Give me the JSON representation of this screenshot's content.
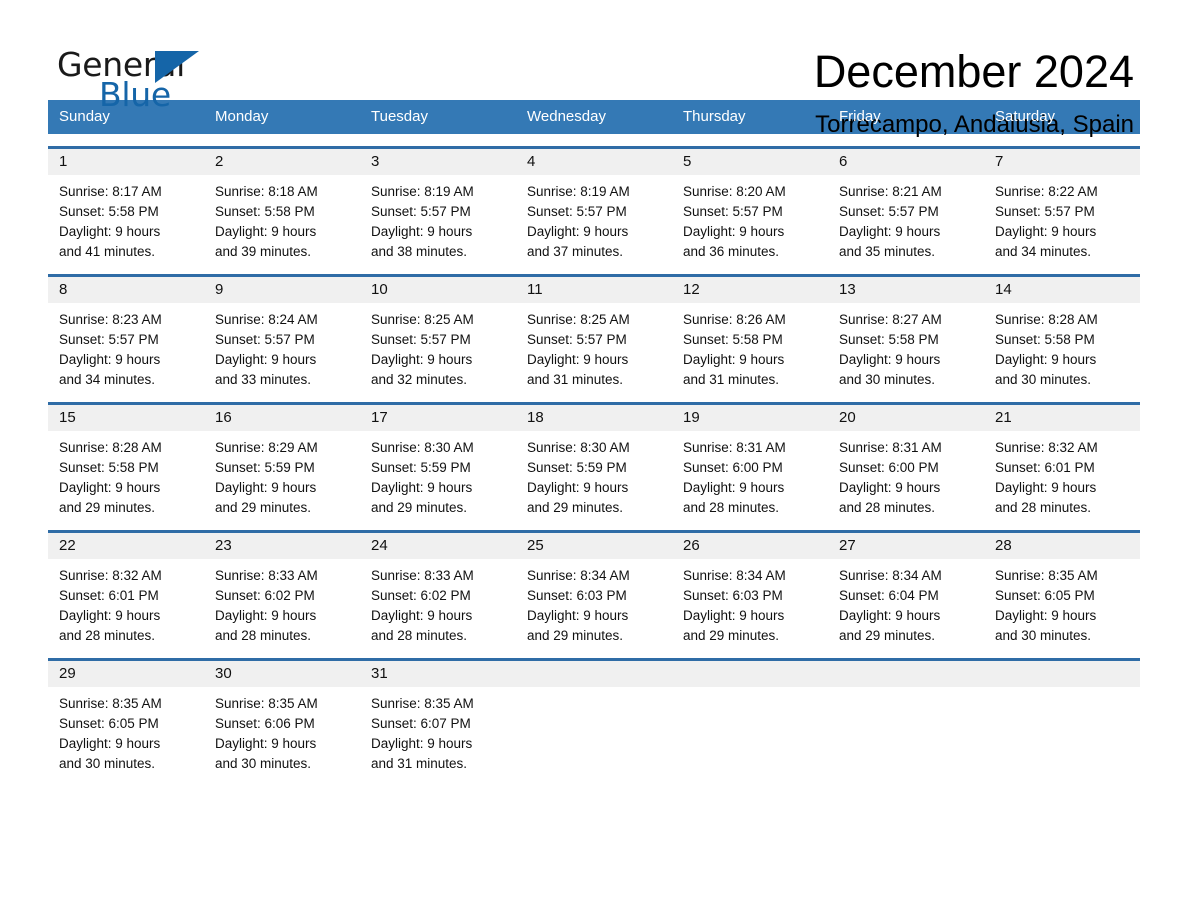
{
  "logo": {
    "word_one": "General",
    "word_two": "Blue",
    "accent_color": "#1565a8"
  },
  "header": {
    "title": "December 2024",
    "subtitle": "Torrecampo, Andalusia, Spain"
  },
  "theme": {
    "header_bar": "#3479b5",
    "row_divider": "#2f6ca6",
    "daynum_band": "#f0f0f0"
  },
  "weekdays": [
    "Sunday",
    "Monday",
    "Tuesday",
    "Wednesday",
    "Thursday",
    "Friday",
    "Saturday"
  ],
  "weeks": [
    [
      {
        "day": "1",
        "sunrise": "Sunrise: 8:17 AM",
        "sunset": "Sunset: 5:58 PM",
        "daylight1": "Daylight: 9 hours",
        "daylight2": "and 41 minutes."
      },
      {
        "day": "2",
        "sunrise": "Sunrise: 8:18 AM",
        "sunset": "Sunset: 5:58 PM",
        "daylight1": "Daylight: 9 hours",
        "daylight2": "and 39 minutes."
      },
      {
        "day": "3",
        "sunrise": "Sunrise: 8:19 AM",
        "sunset": "Sunset: 5:57 PM",
        "daylight1": "Daylight: 9 hours",
        "daylight2": "and 38 minutes."
      },
      {
        "day": "4",
        "sunrise": "Sunrise: 8:19 AM",
        "sunset": "Sunset: 5:57 PM",
        "daylight1": "Daylight: 9 hours",
        "daylight2": "and 37 minutes."
      },
      {
        "day": "5",
        "sunrise": "Sunrise: 8:20 AM",
        "sunset": "Sunset: 5:57 PM",
        "daylight1": "Daylight: 9 hours",
        "daylight2": "and 36 minutes."
      },
      {
        "day": "6",
        "sunrise": "Sunrise: 8:21 AM",
        "sunset": "Sunset: 5:57 PM",
        "daylight1": "Daylight: 9 hours",
        "daylight2": "and 35 minutes."
      },
      {
        "day": "7",
        "sunrise": "Sunrise: 8:22 AM",
        "sunset": "Sunset: 5:57 PM",
        "daylight1": "Daylight: 9 hours",
        "daylight2": "and 34 minutes."
      }
    ],
    [
      {
        "day": "8",
        "sunrise": "Sunrise: 8:23 AM",
        "sunset": "Sunset: 5:57 PM",
        "daylight1": "Daylight: 9 hours",
        "daylight2": "and 34 minutes."
      },
      {
        "day": "9",
        "sunrise": "Sunrise: 8:24 AM",
        "sunset": "Sunset: 5:57 PM",
        "daylight1": "Daylight: 9 hours",
        "daylight2": "and 33 minutes."
      },
      {
        "day": "10",
        "sunrise": "Sunrise: 8:25 AM",
        "sunset": "Sunset: 5:57 PM",
        "daylight1": "Daylight: 9 hours",
        "daylight2": "and 32 minutes."
      },
      {
        "day": "11",
        "sunrise": "Sunrise: 8:25 AM",
        "sunset": "Sunset: 5:57 PM",
        "daylight1": "Daylight: 9 hours",
        "daylight2": "and 31 minutes."
      },
      {
        "day": "12",
        "sunrise": "Sunrise: 8:26 AM",
        "sunset": "Sunset: 5:58 PM",
        "daylight1": "Daylight: 9 hours",
        "daylight2": "and 31 minutes."
      },
      {
        "day": "13",
        "sunrise": "Sunrise: 8:27 AM",
        "sunset": "Sunset: 5:58 PM",
        "daylight1": "Daylight: 9 hours",
        "daylight2": "and 30 minutes."
      },
      {
        "day": "14",
        "sunrise": "Sunrise: 8:28 AM",
        "sunset": "Sunset: 5:58 PM",
        "daylight1": "Daylight: 9 hours",
        "daylight2": "and 30 minutes."
      }
    ],
    [
      {
        "day": "15",
        "sunrise": "Sunrise: 8:28 AM",
        "sunset": "Sunset: 5:58 PM",
        "daylight1": "Daylight: 9 hours",
        "daylight2": "and 29 minutes."
      },
      {
        "day": "16",
        "sunrise": "Sunrise: 8:29 AM",
        "sunset": "Sunset: 5:59 PM",
        "daylight1": "Daylight: 9 hours",
        "daylight2": "and 29 minutes."
      },
      {
        "day": "17",
        "sunrise": "Sunrise: 8:30 AM",
        "sunset": "Sunset: 5:59 PM",
        "daylight1": "Daylight: 9 hours",
        "daylight2": "and 29 minutes."
      },
      {
        "day": "18",
        "sunrise": "Sunrise: 8:30 AM",
        "sunset": "Sunset: 5:59 PM",
        "daylight1": "Daylight: 9 hours",
        "daylight2": "and 29 minutes."
      },
      {
        "day": "19",
        "sunrise": "Sunrise: 8:31 AM",
        "sunset": "Sunset: 6:00 PM",
        "daylight1": "Daylight: 9 hours",
        "daylight2": "and 28 minutes."
      },
      {
        "day": "20",
        "sunrise": "Sunrise: 8:31 AM",
        "sunset": "Sunset: 6:00 PM",
        "daylight1": "Daylight: 9 hours",
        "daylight2": "and 28 minutes."
      },
      {
        "day": "21",
        "sunrise": "Sunrise: 8:32 AM",
        "sunset": "Sunset: 6:01 PM",
        "daylight1": "Daylight: 9 hours",
        "daylight2": "and 28 minutes."
      }
    ],
    [
      {
        "day": "22",
        "sunrise": "Sunrise: 8:32 AM",
        "sunset": "Sunset: 6:01 PM",
        "daylight1": "Daylight: 9 hours",
        "daylight2": "and 28 minutes."
      },
      {
        "day": "23",
        "sunrise": "Sunrise: 8:33 AM",
        "sunset": "Sunset: 6:02 PM",
        "daylight1": "Daylight: 9 hours",
        "daylight2": "and 28 minutes."
      },
      {
        "day": "24",
        "sunrise": "Sunrise: 8:33 AM",
        "sunset": "Sunset: 6:02 PM",
        "daylight1": "Daylight: 9 hours",
        "daylight2": "and 28 minutes."
      },
      {
        "day": "25",
        "sunrise": "Sunrise: 8:34 AM",
        "sunset": "Sunset: 6:03 PM",
        "daylight1": "Daylight: 9 hours",
        "daylight2": "and 29 minutes."
      },
      {
        "day": "26",
        "sunrise": "Sunrise: 8:34 AM",
        "sunset": "Sunset: 6:03 PM",
        "daylight1": "Daylight: 9 hours",
        "daylight2": "and 29 minutes."
      },
      {
        "day": "27",
        "sunrise": "Sunrise: 8:34 AM",
        "sunset": "Sunset: 6:04 PM",
        "daylight1": "Daylight: 9 hours",
        "daylight2": "and 29 minutes."
      },
      {
        "day": "28",
        "sunrise": "Sunrise: 8:35 AM",
        "sunset": "Sunset: 6:05 PM",
        "daylight1": "Daylight: 9 hours",
        "daylight2": "and 30 minutes."
      }
    ],
    [
      {
        "day": "29",
        "sunrise": "Sunrise: 8:35 AM",
        "sunset": "Sunset: 6:05 PM",
        "daylight1": "Daylight: 9 hours",
        "daylight2": "and 30 minutes."
      },
      {
        "day": "30",
        "sunrise": "Sunrise: 8:35 AM",
        "sunset": "Sunset: 6:06 PM",
        "daylight1": "Daylight: 9 hours",
        "daylight2": "and 30 minutes."
      },
      {
        "day": "31",
        "sunrise": "Sunrise: 8:35 AM",
        "sunset": "Sunset: 6:07 PM",
        "daylight1": "Daylight: 9 hours",
        "daylight2": "and 31 minutes."
      },
      {
        "day": "",
        "sunrise": "",
        "sunset": "",
        "daylight1": "",
        "daylight2": ""
      },
      {
        "day": "",
        "sunrise": "",
        "sunset": "",
        "daylight1": "",
        "daylight2": ""
      },
      {
        "day": "",
        "sunrise": "",
        "sunset": "",
        "daylight1": "",
        "daylight2": ""
      },
      {
        "day": "",
        "sunrise": "",
        "sunset": "",
        "daylight1": "",
        "daylight2": ""
      }
    ]
  ]
}
